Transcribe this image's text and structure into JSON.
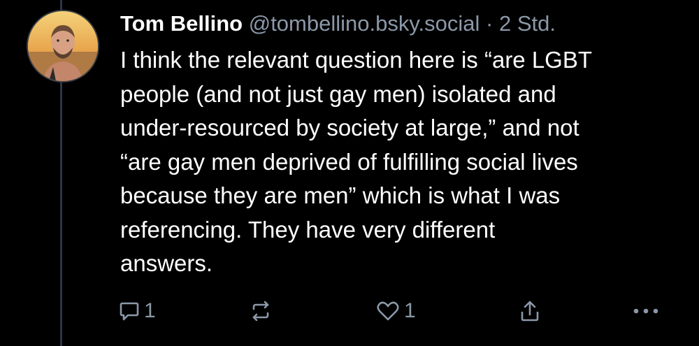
{
  "post": {
    "author_name": "Tom Bellino",
    "author_handle": "@tombellino.bsky.social",
    "separator": "·",
    "time": "2 Std.",
    "text": "I think the relevant question here is “are LGBT\npeople (and not just gay men) isolated and\nunder-resourced by society at large,” and not\n“are gay men deprived of fulfilling social lives\nbecause they are men” which is what I was\nreferencing. They have very different\nanswers."
  },
  "actions": {
    "reply_count": "1",
    "like_count": "1",
    "reply_icon": "speech-bubble-icon",
    "repost_icon": "repost-arrows-icon",
    "like_icon": "heart-icon",
    "share_icon": "share-upload-icon",
    "more_icon": "ellipsis-icon"
  },
  "colors": {
    "background": "#000000",
    "text": "#ffffff",
    "muted": "#8b98a8",
    "thread_line": "#2e3642"
  }
}
